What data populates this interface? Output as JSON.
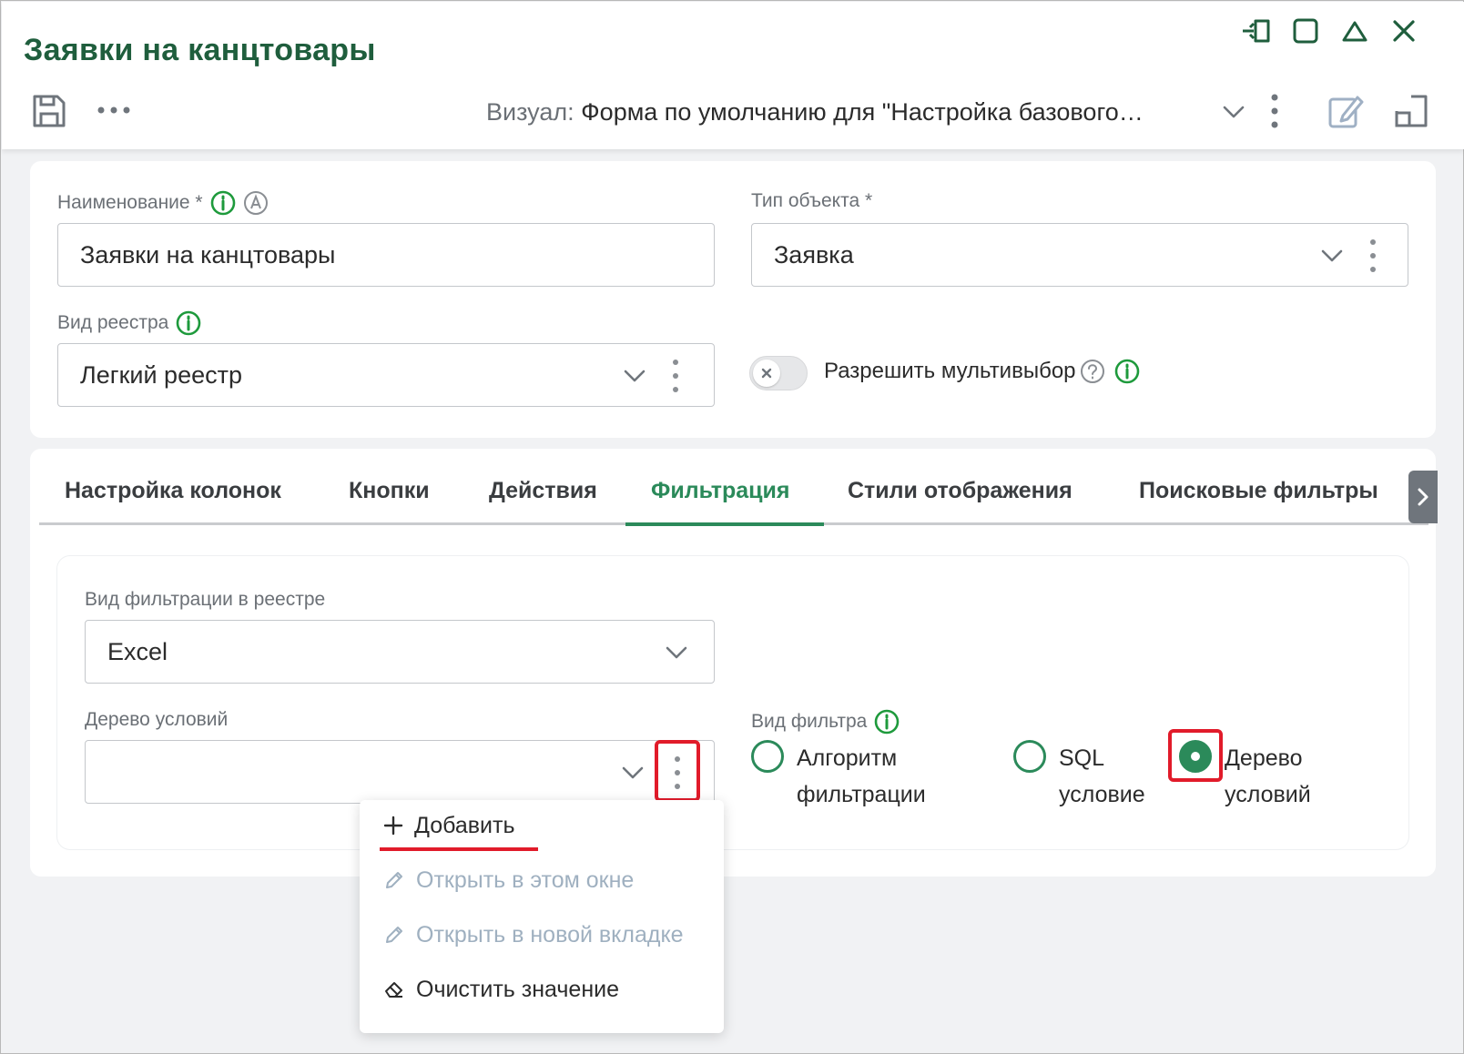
{
  "window": {
    "title": "Заявки на канцтовары",
    "controls": [
      "pin-icon",
      "maximize-icon",
      "collapse-icon",
      "close-icon"
    ]
  },
  "toolbar": {
    "visual_label": "Визуал:",
    "visual_value": "Форма по умолчанию для \"Настройка базового…"
  },
  "form": {
    "name_label": "Наименование *",
    "name_value": "Заявки на канцтовары",
    "object_type_label": "Тип объекта *",
    "object_type_value": "Заявка",
    "registry_kind_label": "Вид реестра",
    "registry_kind_value": "Легкий реестр",
    "multiselect_label": "Разрешить мультивыбор",
    "multiselect_enabled": false
  },
  "tabs": [
    {
      "label": "Настройка колонок"
    },
    {
      "label": "Кнопки"
    },
    {
      "label": "Действия"
    },
    {
      "label": "Фильтрация",
      "active": true
    },
    {
      "label": "Стили отображения"
    },
    {
      "label": "Поисковые фильтры"
    }
  ],
  "filtering": {
    "filter_kind_label": "Вид фильтрации в реестре",
    "filter_kind_value": "Excel",
    "condition_tree_label": "Дерево условий",
    "condition_tree_value": "",
    "filter_type_label": "Вид фильтра",
    "options": [
      {
        "line1": "Алгоритм",
        "line2": "фильтрации",
        "checked": false
      },
      {
        "line1": "SQL",
        "line2": "условие",
        "checked": false
      },
      {
        "line1": "Дерево",
        "line2": "условий",
        "checked": true
      }
    ]
  },
  "context_menu": {
    "items": [
      {
        "label": "Добавить",
        "icon": "plus-icon",
        "enabled": true
      },
      {
        "label": "Открыть в этом окне",
        "icon": "pencil-icon",
        "enabled": false
      },
      {
        "label": "Открыть в новой вкладке",
        "icon": "pencil-icon",
        "enabled": false
      },
      {
        "label": "Очистить значение",
        "icon": "eraser-icon",
        "enabled": true
      }
    ]
  },
  "colors": {
    "accent": "#2b8a5a",
    "title": "#1f5e3d",
    "highlight": "#e11b2a"
  }
}
